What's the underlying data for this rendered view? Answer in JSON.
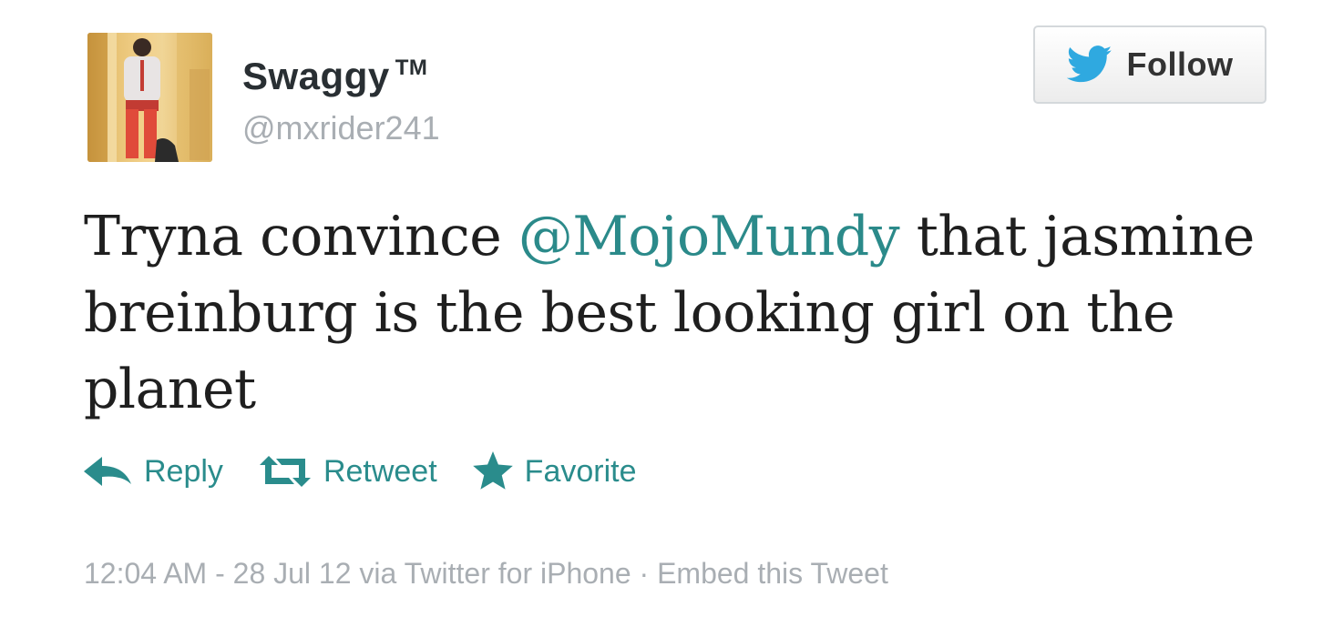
{
  "user": {
    "display_name": "Swaggy",
    "tm": "TM",
    "handle": "@mxrider241"
  },
  "follow_button": {
    "label": "Follow",
    "icon": "twitter-bird-icon"
  },
  "tweet": {
    "text_before": "Tryna convince ",
    "mention": "@MojoMundy",
    "text_after": " that jasmine breinburg is the best looking girl on the planet"
  },
  "actions": {
    "reply": {
      "label": "Reply",
      "icon": "reply-arrow-icon"
    },
    "retweet": {
      "label": "Retweet",
      "icon": "retweet-icon"
    },
    "favorite": {
      "label": "Favorite",
      "icon": "star-icon"
    }
  },
  "meta": {
    "timestamp": "12:04 AM - 28 Jul 12",
    "via": "via Twitter for iPhone",
    "separator": "·",
    "embed": "Embed this Tweet"
  },
  "colors": {
    "accent": "#2a8c8c",
    "twitter_blue": "#2fa9e0",
    "muted": "#a9aeb3",
    "text": "#1f1f1f"
  }
}
